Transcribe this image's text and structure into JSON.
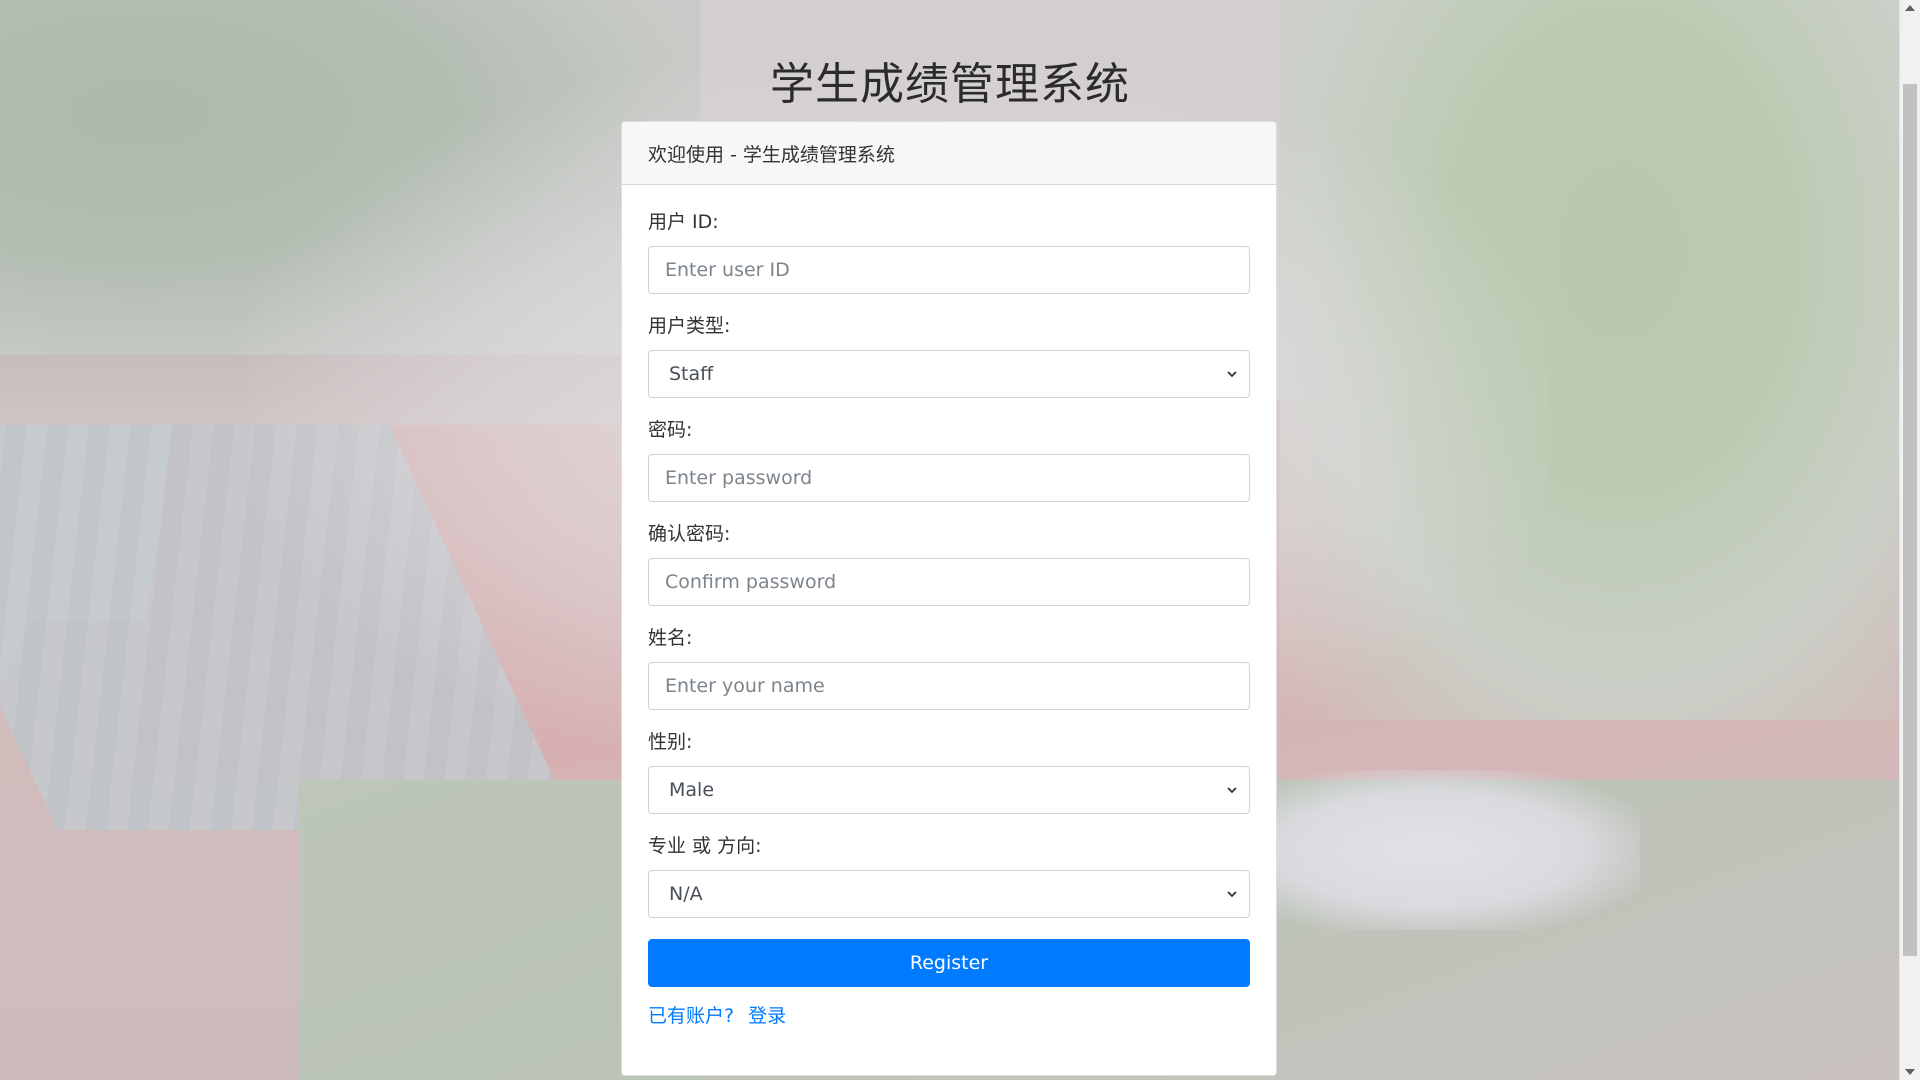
{
  "page": {
    "title": "学生成绩管理系统"
  },
  "card": {
    "header": "欢迎使用 - 学生成绩管理系统"
  },
  "form": {
    "user_id": {
      "label": "用户 ID:",
      "placeholder": "Enter user ID"
    },
    "user_type": {
      "label": "用户类型:",
      "selected": "Staff"
    },
    "password": {
      "label": "密码:",
      "placeholder": "Enter password"
    },
    "confirm_password": {
      "label": "确认密码:",
      "placeholder": "Confirm password"
    },
    "name": {
      "label": "姓名:",
      "placeholder": "Enter your name"
    },
    "gender": {
      "label": "性别:",
      "selected": "Male"
    },
    "major": {
      "label": "专业 或 方向:",
      "selected": "N/A"
    },
    "register_label": "Register",
    "has_account": "已有账户?",
    "login_link": "登录"
  },
  "colors": {
    "primary": "#007bff",
    "header_bg": "#f7f7f7"
  },
  "icons": {
    "select": "chevron-down-icon"
  }
}
